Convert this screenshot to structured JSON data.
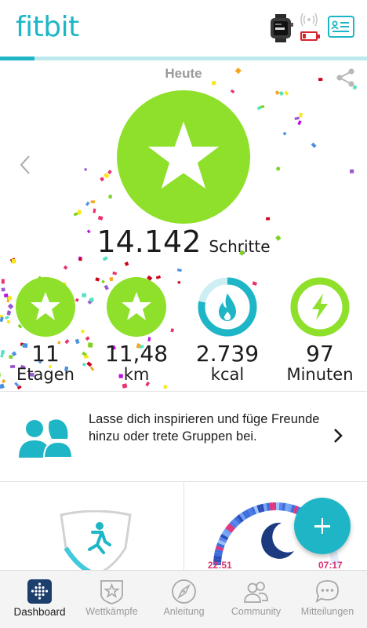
{
  "header": {
    "logo": "fitbit",
    "device_icon": "smartwatch-icon",
    "battery_icon": "battery-low-icon",
    "sync_icon": "signal-icon",
    "profile_icon": "profile-card-icon",
    "sync_progress": 0.095,
    "accent_color": "#1eb6c6"
  },
  "hero": {
    "date_label": "Heute",
    "steps_value": "14.142",
    "steps_unit": "Schritte",
    "goal_color": "#8ee02b"
  },
  "stats": [
    {
      "value": "11",
      "label": "Etagen",
      "state": "goal-reached"
    },
    {
      "value": "11,48",
      "label": "km",
      "state": "goal-reached"
    },
    {
      "value": "2.739",
      "label": "kcal",
      "state": "progress",
      "progress": 0.78
    },
    {
      "value": "97",
      "label": "Minuten",
      "state": "progress",
      "progress": 1.0
    }
  ],
  "inspire": {
    "text": "Lasse dich inspirieren und füge Freunde hinzu oder trete Gruppen bei."
  },
  "sleep": {
    "start": "22:51",
    "end": "07:17"
  },
  "nav": [
    {
      "label": "Dashboard",
      "icon": "dashboard-icon",
      "active": true
    },
    {
      "label": "Wettkämpfe",
      "icon": "challenges-star-icon",
      "active": false
    },
    {
      "label": "Anleitung",
      "icon": "compass-icon",
      "active": false
    },
    {
      "label": "Community",
      "icon": "community-icon",
      "active": false
    },
    {
      "label": "Mitteilungen",
      "icon": "messages-icon",
      "active": false
    }
  ]
}
